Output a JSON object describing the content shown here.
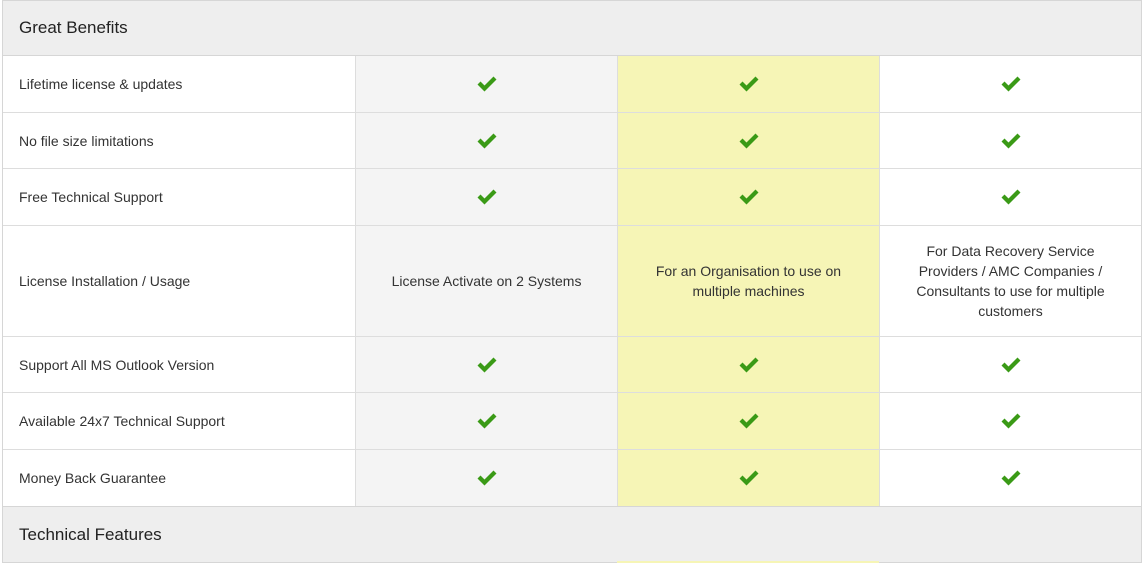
{
  "sections": [
    {
      "title": "Great Benefits",
      "rows": [
        {
          "label": "Lifetime license & updates",
          "values": [
            "check",
            "check",
            "check"
          ]
        },
        {
          "label": "No file size limitations",
          "values": [
            "check",
            "check",
            "check"
          ]
        },
        {
          "label": "Free Technical Support",
          "values": [
            "check",
            "check",
            "check"
          ]
        },
        {
          "label": "License Installation / Usage",
          "values": [
            "License Activate on 2 Systems",
            "For an Organisation to use on multiple machines",
            "For Data Recovery Service Providers / AMC Companies / Consultants to use for multiple customers"
          ]
        },
        {
          "label": "Support All MS Outlook Version",
          "values": [
            "check",
            "check",
            "check"
          ]
        },
        {
          "label": "Available 24x7 Technical Support",
          "values": [
            "check",
            "check",
            "check"
          ]
        },
        {
          "label": "Money Back Guarantee",
          "values": [
            "check",
            "check",
            "check"
          ]
        }
      ]
    },
    {
      "title": "Technical Features",
      "rows": []
    }
  ],
  "colors": {
    "check": "#3a9a16",
    "highlight_column": "#f6f5b6",
    "shaded_column": "#f4f4f4",
    "section_header_bg": "#eeeeee"
  },
  "icons": {
    "check": "check-icon"
  }
}
